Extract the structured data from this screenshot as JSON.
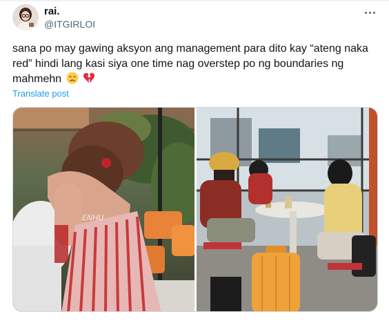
{
  "author": {
    "display_name": "rai.",
    "handle": "@ITGIRLOI"
  },
  "tweet": {
    "text": "sana po may gawing aksyon ang management para dito kay “ateng naka red” hindi lang kasi siya one time nag overstep po ng boundaries ng mahmehn",
    "emojis": [
      "disappointed-face",
      "broken-heart"
    ],
    "translate_label": "Translate post"
  },
  "media": {
    "photos": [
      {
        "icon": "photo-left",
        "watermark": "ENHU"
      },
      {
        "icon": "photo-right",
        "watermark": ""
      }
    ]
  },
  "colors": {
    "link": "#1d9bf0",
    "secondary_text": "#536471",
    "border": "#cfd9de"
  }
}
